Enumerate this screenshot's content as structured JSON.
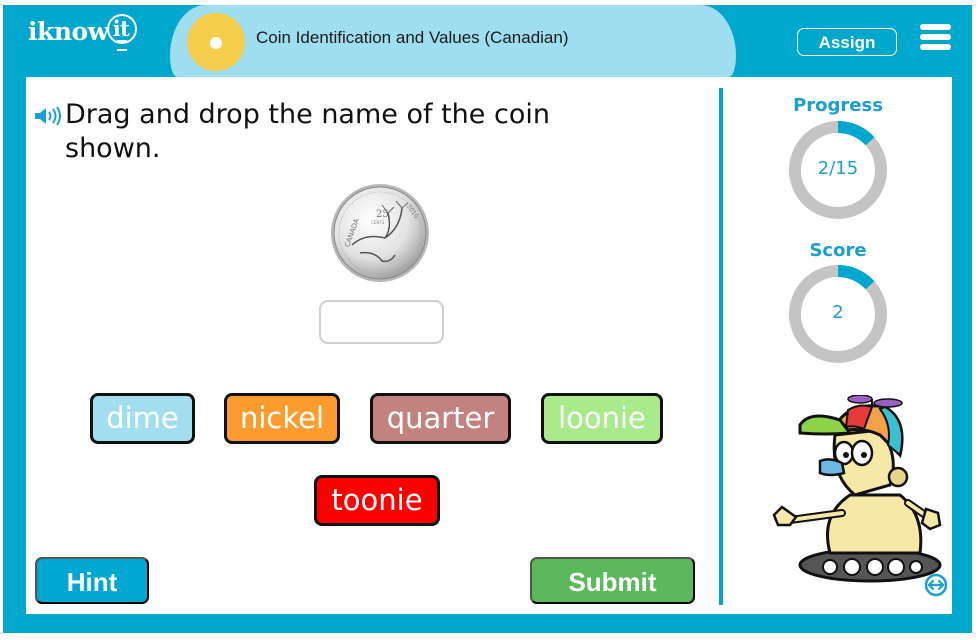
{
  "header": {
    "logo_text": "iknow",
    "logo_text_bulb": "it",
    "lesson_title": "Coin Identification and Values (Canadian)",
    "assign_label": "Assign",
    "menu_icon": "hamburger-menu-icon"
  },
  "question": {
    "audio_icon": "speaker-icon",
    "prompt": "Drag and drop the name of the coin shown.",
    "coin_image": "canadian-quarter-25-cents-caribou-2010",
    "coin_text": {
      "country": "CANADA",
      "denomination": "25",
      "unit": "CENTS",
      "year": "2010"
    },
    "answer_box_value": ""
  },
  "tiles": [
    {
      "label": "dime",
      "color": "#a3def0"
    },
    {
      "label": "nickel",
      "color": "#fc9c2e"
    },
    {
      "label": "quarter",
      "color": "#c18280"
    },
    {
      "label": "loonie",
      "color": "#a9ea8c"
    },
    {
      "label": "toonie",
      "color": "#fc0000"
    }
  ],
  "buttons": {
    "hint_label": "Hint",
    "submit_label": "Submit"
  },
  "sidebar": {
    "progress": {
      "label": "Progress",
      "value_text": "2/15",
      "current": 2,
      "total": 15
    },
    "score": {
      "label": "Score",
      "value_text": "2",
      "fraction": 0.133
    },
    "mascot": "robot-mascot-propeller-cap",
    "toggle_icon": "expand-horizontal-icon"
  },
  "colors": {
    "brand_teal": "#00a7cd",
    "title_tab": "#9fdef0",
    "ring_track": "#c4c4c4",
    "ring_fill": "#00a7cd",
    "hint": "#00a7d0",
    "submit": "#5cb85c"
  }
}
